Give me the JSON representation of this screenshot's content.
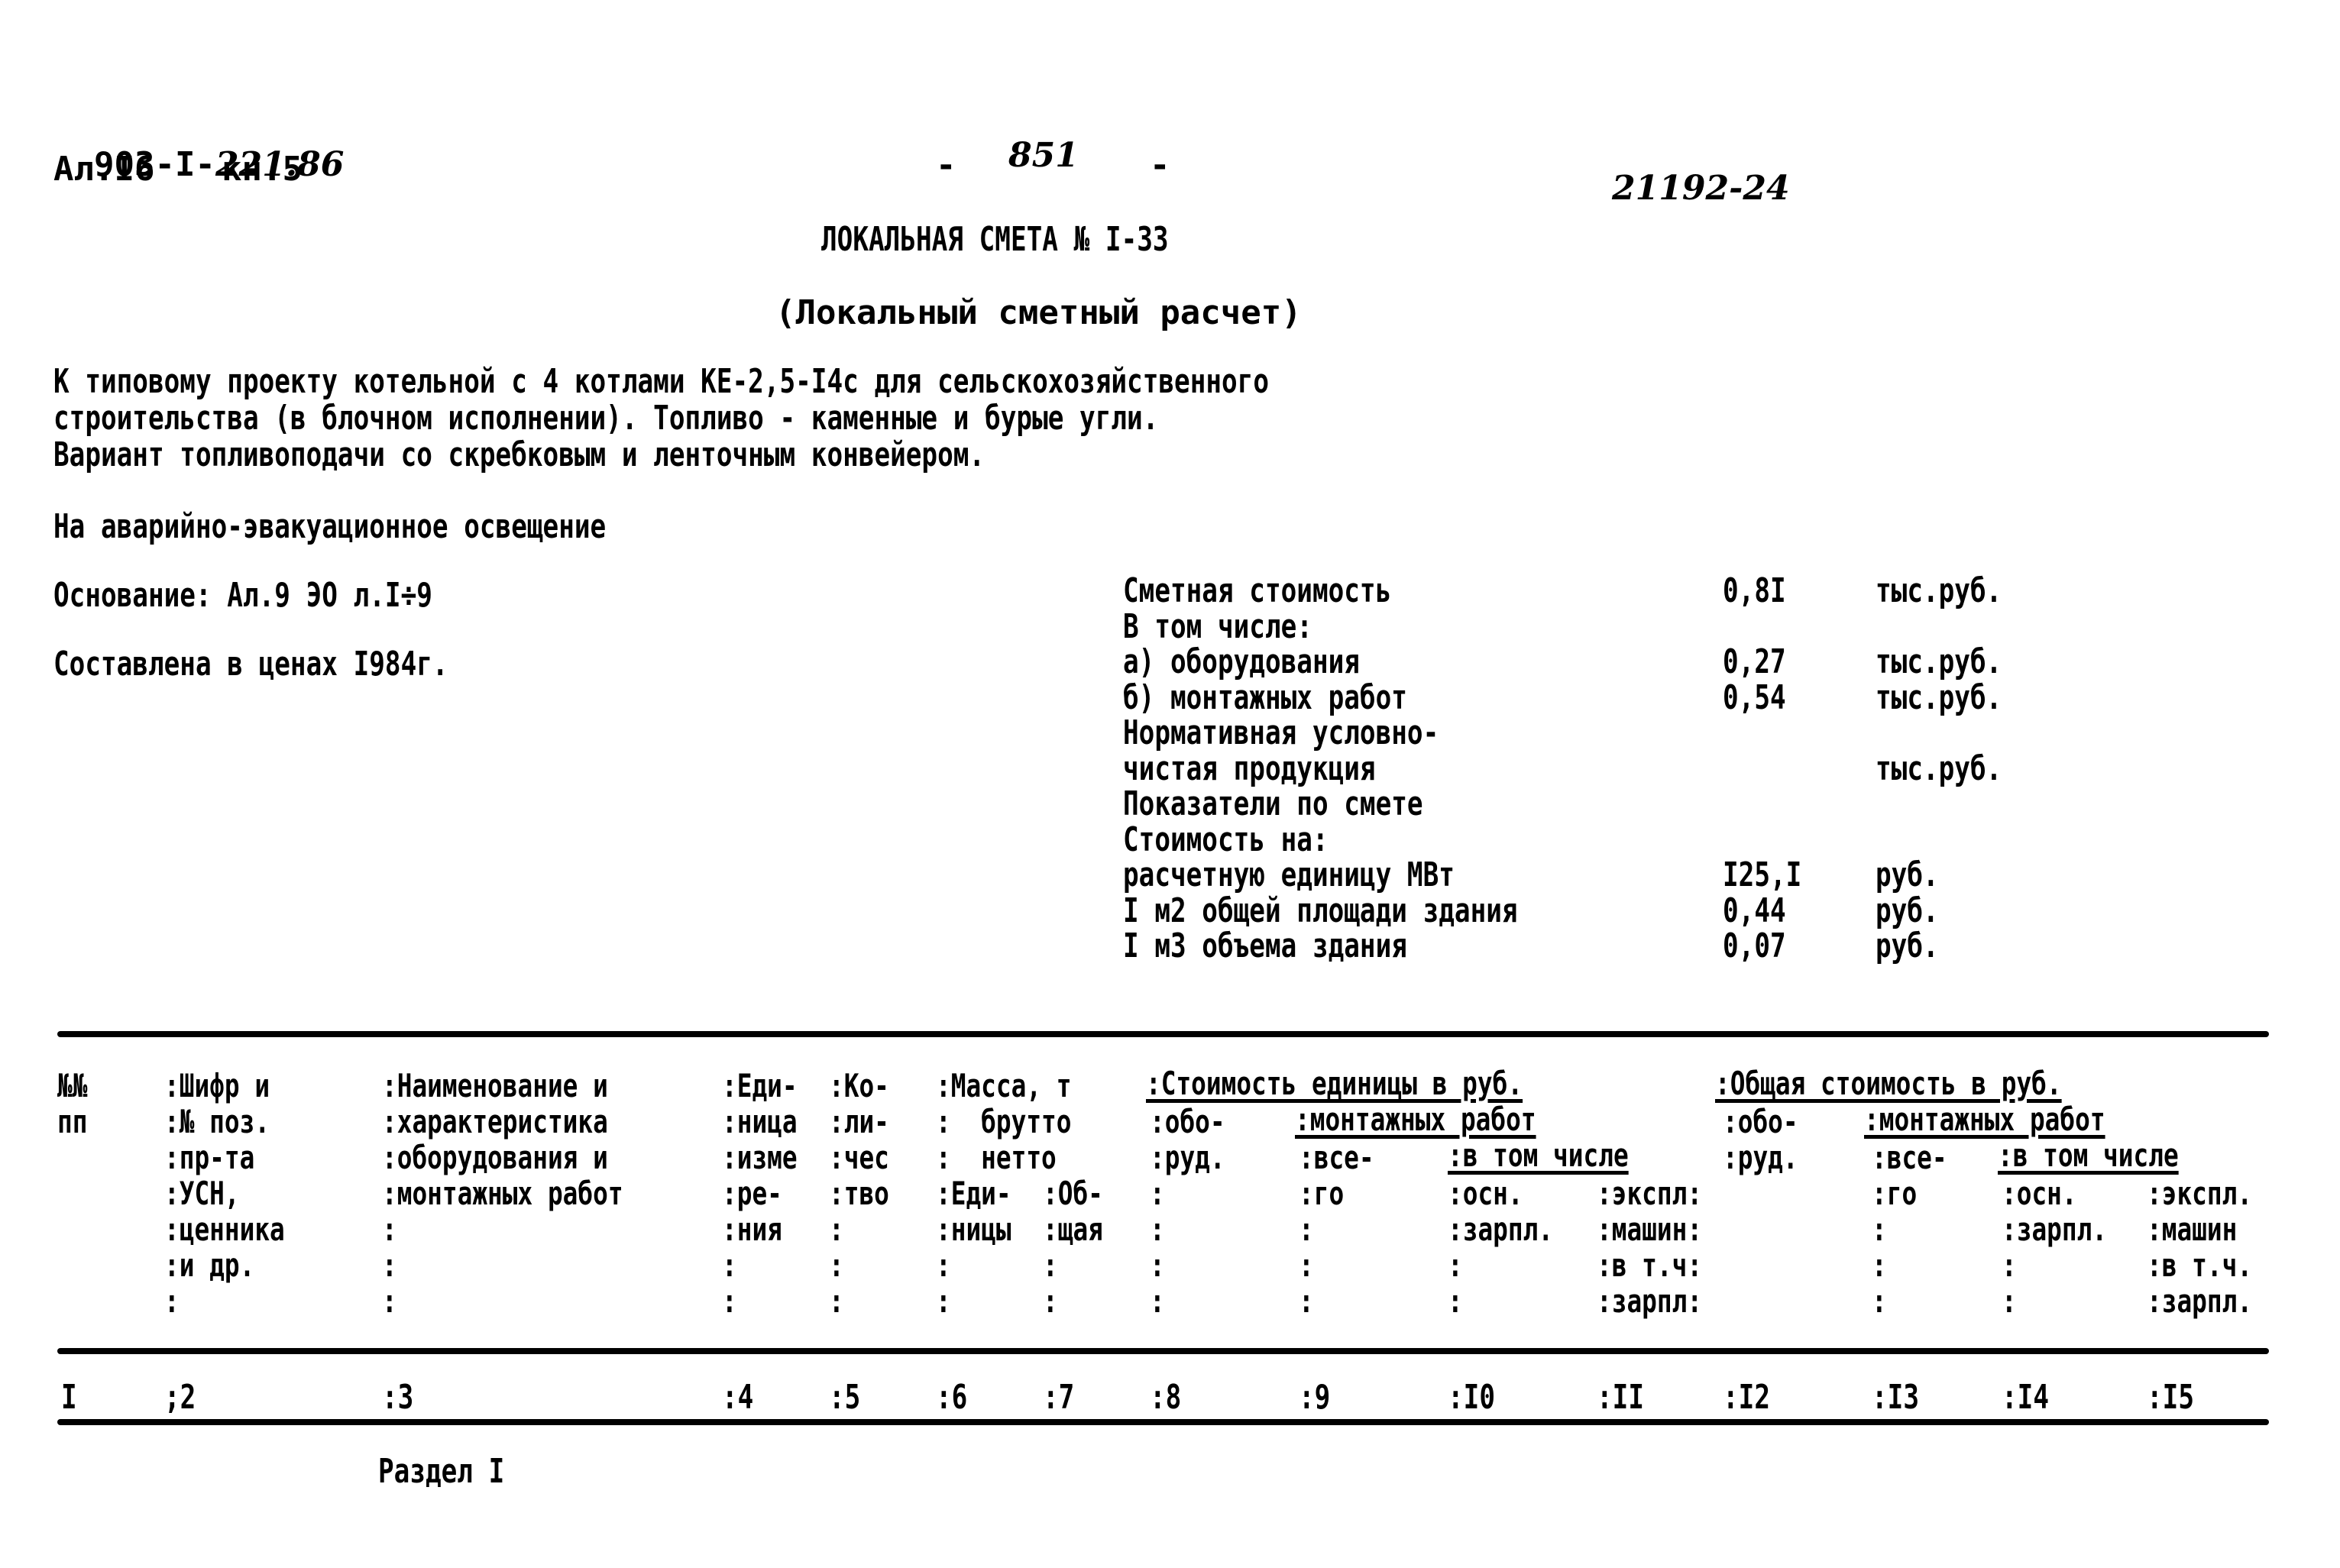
{
  "header": {
    "doc_code_prefix": "903-I-",
    "doc_code_handwritten": "221.86",
    "album": "Ал.I6",
    "book": "кн.5",
    "page_number_handwritten": "851",
    "page_dash_left": "-",
    "page_dash_right": "-",
    "inventory_number_handwritten": "21192-24"
  },
  "title": "ЛОКАЛЬНАЯ СМЕТА № I-33",
  "subtitle": "(Локальный сметный расчет)",
  "description_lines": [
    "К типовому проекту котельной с 4 котлами КЕ-2,5-I4с для сельскохозяйственного",
    "строительства (в блочном исполнении). Топливо - каменные и бурые угли.",
    "Вариант топливоподачи со скребковым и ленточным конвейером."
  ],
  "object": "На аварийно-эвакуационное освещение",
  "basis": "Основание: Ал.9 ЭО л.I÷9",
  "prices": "Составлена в ценах I984г.",
  "cost_summary": [
    {
      "label": "Сметная стоимость",
      "value": "0,8I",
      "unit": "тыс.руб."
    },
    {
      "label": "В том числе:",
      "value": "",
      "unit": ""
    },
    {
      "label": "а) оборудования",
      "value": "0,27",
      "unit": "тыс.руб."
    },
    {
      "label": "б) монтажных работ",
      "value": "0,54",
      "unit": "тыс.руб."
    },
    {
      "label": "Нормативная условно-",
      "value": "",
      "unit": ""
    },
    {
      "label": "чистая продукция",
      "value": "",
      "unit": "тыс.руб."
    },
    {
      "label": "Показатели по смете",
      "value": "",
      "unit": ""
    },
    {
      "label": "Стоимость на:",
      "value": "",
      "unit": ""
    },
    {
      "label": "расчетную единицу МВт",
      "value": "I25,I",
      "unit": "руб."
    },
    {
      "label": "I м2 общей площади здания",
      "value": "0,44",
      "unit": "руб."
    },
    {
      "label": "I м3 объема здания",
      "value": "0,07",
      "unit": "руб."
    }
  ],
  "table": {
    "header_columns": [
      {
        "lines": [
          "№№",
          "пп"
        ]
      },
      {
        "lines": [
          ":Шифр и",
          ":№ поз.",
          ":пр-та",
          ":УСН,",
          ":ценника",
          ":и др.",
          ":"
        ]
      },
      {
        "lines": [
          ":Наименование и",
          ":характеристика",
          ":оборудования и",
          ":монтажных работ",
          ":",
          ":",
          ":"
        ]
      },
      {
        "lines": [
          ":Еди-",
          ":ница",
          ":изме",
          ":ре-",
          ":ния",
          ":",
          ":"
        ]
      },
      {
        "lines": [
          ":Ко-",
          ":ли-",
          ":чес",
          ":тво",
          ":",
          ":",
          ":"
        ]
      },
      {
        "lines": [
          ":Масса, т",
          ":  брутто",
          ":  нетто",
          ":Еди-",
          ":ницы",
          ":",
          ":"
        ]
      },
      {
        "lines": [
          "",
          "",
          "",
          ":Об-",
          ":щая",
          ":",
          ":"
        ]
      },
      {
        "lines": [
          "",
          ":обо-",
          ":руд.",
          ":",
          ":",
          ":",
          ":"
        ]
      },
      {
        "lines": [
          "",
          "",
          ":все-",
          ":го",
          ":",
          ":",
          ":"
        ]
      },
      {
        "lines": [
          "",
          "",
          "",
          ":осн.",
          ":зарпл.",
          ":",
          ":"
        ]
      },
      {
        "lines": [
          "",
          "",
          "",
          ":экспл:",
          ":машин:",
          ":в т.ч:",
          ":зарпл:"
        ]
      },
      {
        "lines": [
          "",
          ":обо-",
          ":руд."
        ]
      },
      {
        "lines": [
          "",
          "",
          ":все-",
          ":го",
          ":",
          ":",
          ":"
        ]
      },
      {
        "lines": [
          "",
          "",
          "",
          ":осн.",
          ":зарпл.",
          ":",
          ":"
        ]
      },
      {
        "lines": [
          "",
          "",
          "",
          ":экспл.",
          ":машин",
          ":в т.ч.",
          ":зарпл."
        ]
      }
    ],
    "group_headers": {
      "unit_cost": ":Стоимость единицы в руб.",
      "unit_cost_mounting": ":монтажных работ",
      "unit_cost_incl": ":в том числе",
      "total_cost": ":Общая стоимость в руб.",
      "total_cost_mounting": ":монтажных работ",
      "total_cost_incl": ":в том числе"
    },
    "column_numbers": [
      "I",
      ";2",
      ":3",
      ":4",
      ":5",
      ":6",
      ":7",
      ":8",
      ":9",
      ":I0",
      ":II",
      ":I2",
      ":I3",
      ":I4",
      ":I5"
    ]
  },
  "section_title": "Раздел I"
}
